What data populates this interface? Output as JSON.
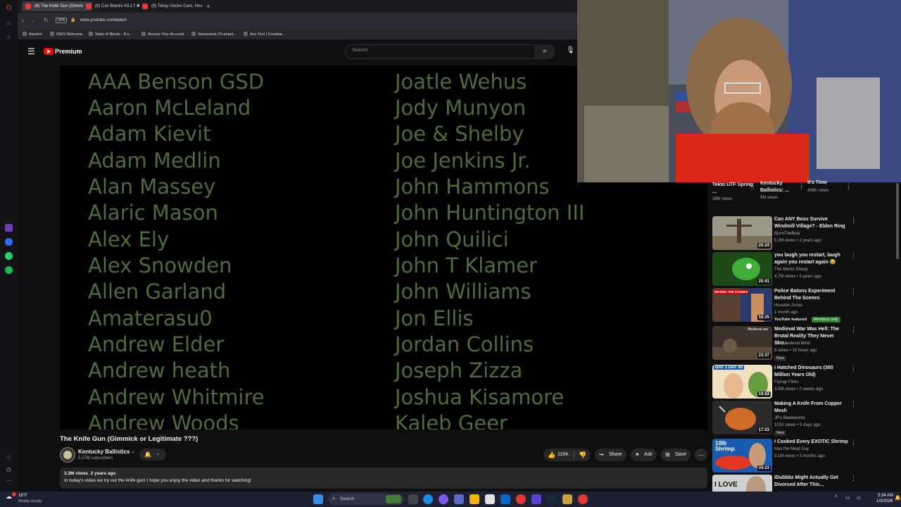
{
  "browser": {
    "tabs": [
      {
        "title": "(6) The Knife Gun (Gimmi",
        "active": true
      },
      {
        "title": "(6) Can Blanks KILL? ✖",
        "active": false
      },
      {
        "title": "(6) Tokay Gecko Care, Hou",
        "active": false
      }
    ],
    "new_tab": "+",
    "url": "www.youtube.com/watch",
    "vpn": "VPN",
    "bookmarks": [
      "Asurion",
      "IDES Welcome",
      "State of Illinois - ILo...",
      "Access Your Account",
      "Sarracenia (Trumpet...",
      "Axe Tool | Crowbar..."
    ]
  },
  "youtube": {
    "logo": "Premium",
    "search_placeholder": "Search"
  },
  "credits": {
    "left": [
      "AAA Benson GSD",
      "Aaron McLeland",
      "Adam Kievit",
      "Adam Medlin",
      "Alan Massey",
      "Alaric Mason",
      "Alex Ely",
      "Alex Snowden",
      "Allen Garland",
      "Amaterasu0",
      "Andrew Elder",
      "Andrew heath",
      "Andrew Whitmire",
      "Andrew Woods"
    ],
    "right": [
      "Joatle Wehus",
      "Jody Munyon",
      "Joe & Shelby",
      "Joe Jenkins Jr.",
      "John Hammons",
      "John Huntington III",
      "John Quilici",
      "John T Klamer",
      "John Williams",
      "Jon Ellis",
      "Jordan Collins",
      "Joseph Zizza",
      "Joshua Kisamore",
      "Kaleb Geer"
    ]
  },
  "video": {
    "title": "The Knife Gun (Gimmick or Legitimate ???)",
    "channel": "Kentucky Ballistics",
    "subscribers": "5.57M subscribers",
    "likes": "115K",
    "share": "Share",
    "ask": "Ask",
    "save": "Save",
    "views": "3.3M views",
    "age": "2 years ago",
    "description": "In today's video we try out the knife gun! I hope you enjoy the video and thanks for watching!"
  },
  "shorts": [
    {
      "title": "Tekto UTF Spring ...",
      "views": "38M views"
    },
    {
      "title": "Kentucky Ballistics: ...",
      "views": "5M views"
    },
    {
      "title": "It's Time",
      "views": "406K views"
    }
  ],
  "recommendations": [
    {
      "title": "Can ANY Boss Survive Windmill Village? - Elden Ring",
      "channel": "BjornTheBear",
      "meta": "5.3M views • 2 years ago",
      "duration": "20:24",
      "badge": "",
      "thumb_color": "#8a8a7a"
    },
    {
      "title": "you laugh you restart, laugh again you restart again 😂",
      "channel": "The Meme Sheep",
      "meta": "4.7M views • 2 years ago",
      "duration": "20:41",
      "badge": "",
      "thumb_color": "#2f6b2a"
    },
    {
      "title": "Police Batons Experiment Behind The Scenes",
      "channel": "Houston Jones",
      "meta": "1 month ago",
      "duration": "16:25",
      "badge": "YouTube featured",
      "members": "Members only",
      "thumb_color": "#6b4a3a"
    },
    {
      "title": "Medieval War Was Hell: The Brutal Reality They Never Sho...",
      "channel": "The Medieval Mind",
      "meta": "8 views • 10 hours ago",
      "duration": "23:37",
      "badge": "New",
      "thumb_color": "#4a3f35"
    },
    {
      "title": "I Hatched Dinosaurs (300 Million Years Old)",
      "channel": "Flytrap Films",
      "meta": "3.5M views • 2 weeks ago",
      "duration": "19:53",
      "badge": "",
      "thumb_color": "#e0c890"
    },
    {
      "title": "Making A Knife From Copper Mesh",
      "channel": "JP's Bladeworks",
      "meta": "101K views • 5 days ago",
      "duration": "17:03",
      "badge": "New",
      "thumb_color": "#c06020"
    },
    {
      "title": "I Cooked Every EXOTIC Shrimp",
      "channel": "Max the Meat Guy",
      "meta": "3.1M views • 3 months ago",
      "duration": "34:23",
      "badge": "",
      "thumb_color": "#1a5ab0"
    },
    {
      "title": "IDubbbz Might Actually Get Divorced After This...",
      "channel": "",
      "meta": "",
      "duration": "",
      "badge": "",
      "thumb_color": "#d0d0d0"
    }
  ],
  "thumb_texts": [
    "BEHIND THE SCENES",
    "Medieval war",
    "DAY 1 DAY 50",
    "10lb Shrimp",
    "I LOVE"
  ],
  "taskbar": {
    "weather_temp": "16°F",
    "weather_desc": "Mostly cloudy",
    "search": "Search",
    "time": "5:34 AM",
    "date": "1/3/2026"
  }
}
